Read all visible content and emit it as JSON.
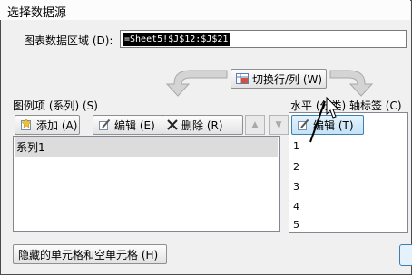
{
  "dialog": {
    "title": "选择数据源",
    "range_label": "图表数据区域 (D):",
    "range_value": "=Sheet5!$J$12:$J$21",
    "switch_label": "切换行/列 (W)",
    "hidden_cells_label": "隐藏的单元格和空单元格 (H)"
  },
  "legend": {
    "label": "图例项 (系列) (S)",
    "add_label": "添加 (A)",
    "edit_label": "编辑 (E)",
    "delete_label": "删除 (R)",
    "series": [
      "系列1"
    ]
  },
  "axis": {
    "label": "水平 (分类) 轴标签 (C)",
    "edit_label": "编辑 (T)",
    "items": [
      "1",
      "2",
      "3",
      "4",
      "5"
    ]
  }
}
